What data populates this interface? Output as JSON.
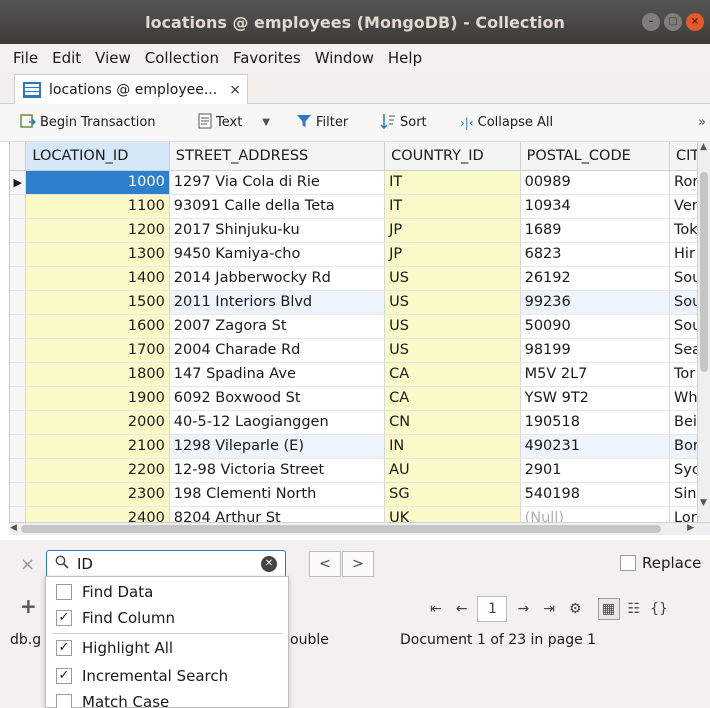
{
  "window": {
    "title": "locations @ employees (MongoDB) - Collection",
    "controls": [
      "–",
      "□",
      "×"
    ]
  },
  "menubar": [
    {
      "label": "File"
    },
    {
      "label": "Edit"
    },
    {
      "label": "View"
    },
    {
      "label": "Collection"
    },
    {
      "label": "Favorites"
    },
    {
      "label": "Window"
    },
    {
      "label": "Help"
    }
  ],
  "tab": {
    "label": "locations @ employee...",
    "close": "×"
  },
  "toolbar": {
    "begin_transaction": "Begin Transaction",
    "text": "Text",
    "filter": "Filter",
    "sort": "Sort",
    "collapse_all": "Collapse All",
    "overflow": "»"
  },
  "grid": {
    "columns": [
      "LOCATION_ID",
      "STREET_ADDRESS",
      "COUNTRY_ID",
      "POSTAL_CODE",
      "CIT"
    ],
    "rows": [
      [
        "1000",
        "1297 Via Cola di Rie",
        "IT",
        "00989",
        "Ror"
      ],
      [
        "1100",
        "93091 Calle della Teta",
        "IT",
        "10934",
        "Ver"
      ],
      [
        "1200",
        "2017 Shinjuku-ku",
        "JP",
        "1689",
        "Tok"
      ],
      [
        "1300",
        "9450 Kamiya-cho",
        "JP",
        "6823",
        "Hir"
      ],
      [
        "1400",
        "2014 Jabberwocky Rd",
        "US",
        "26192",
        "Sou"
      ],
      [
        "1500",
        "2011 Interiors Blvd",
        "US",
        "99236",
        "Sou"
      ],
      [
        "1600",
        "2007 Zagora St",
        "US",
        "50090",
        "Sou"
      ],
      [
        "1700",
        "2004 Charade Rd",
        "US",
        "98199",
        "Sea"
      ],
      [
        "1800",
        "147 Spadina Ave",
        "CA",
        "M5V 2L7",
        "Tor"
      ],
      [
        "1900",
        "6092 Boxwood St",
        "CA",
        "YSW 9T2",
        "Wh"
      ],
      [
        "2000",
        "40-5-12 Laogianggen",
        "CN",
        "190518",
        "Bei"
      ],
      [
        "2100",
        "1298 Vileparle (E)",
        "IN",
        "490231",
        "Bor"
      ],
      [
        "2200",
        "12-98 Victoria Street",
        "AU",
        "2901",
        "Syc"
      ],
      [
        "2300",
        "198 Clementi North",
        "SG",
        "540198",
        "Sin"
      ],
      [
        "2400",
        "8204 Arthur St",
        "UK",
        "(Null)",
        "Lor"
      ]
    ],
    "selected_row_marker": "▶"
  },
  "find": {
    "value": "ID",
    "prev": "<",
    "next": ">",
    "replace_label": "Replace",
    "close": "×"
  },
  "find_options": [
    {
      "label": "Find Data",
      "checked": false
    },
    {
      "label": "Find Column",
      "checked": true
    },
    {
      "label": "Highlight All",
      "checked": true
    },
    {
      "label": "Incremental Search",
      "checked": true
    },
    {
      "label": "Match Case",
      "checked": false
    }
  ],
  "status": {
    "left_text": "db.g",
    "partial": "ouble",
    "document_info": "Document 1 of 23 in page 1",
    "page_number": "1",
    "add": "+"
  },
  "colors": {
    "accent": "#2b79c2",
    "selected": "#2f7fcf",
    "key_column": "#fafac8",
    "titlebar": "#3c3b37"
  }
}
